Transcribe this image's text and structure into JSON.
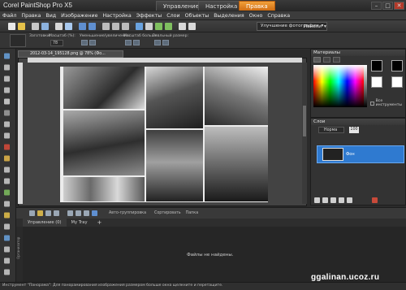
{
  "app": {
    "title": "Corel PaintShop Pro X5"
  },
  "workspace_tabs": [
    {
      "label": "Управление"
    },
    {
      "label": "Настройка"
    },
    {
      "label": "Правка"
    }
  ],
  "window_controls": {
    "minimize": "–",
    "maximize": "□",
    "close": "✕"
  },
  "menu": [
    "Файл",
    "Правка",
    "Вид",
    "Изображение",
    "Настройка",
    "Эффекты",
    "Слои",
    "Объекты",
    "Выделения",
    "Окно",
    "Справка"
  ],
  "toolbar": {
    "enhance_label": "Улучшение фотографии",
    "enhance_arrow": "▾",
    "panels_label": "Панели",
    "panels_arrow": "▾"
  },
  "options": {
    "label1": "Заготовки:",
    "label2": "Масштаб (%):",
    "value2": "78",
    "label3": "Уменьшение/увеличение:",
    "label4": "Масштаб больше:",
    "label5": "Реальный размер:"
  },
  "document": {
    "tab_label": "2012-03-14_195128.png @ 78% (Фо..."
  },
  "materials": {
    "title": "Материалы",
    "all_tools": "Все инструменты",
    "colors": {
      "fg": "#000000",
      "bg": "#000000"
    }
  },
  "layers": {
    "title": "Слои",
    "mode": "Норма",
    "opacity": "100",
    "layer_name": "Фон"
  },
  "organizer": {
    "auto_group": "Авто-группировка",
    "sort": "Сортировать",
    "sort_value": "Папка",
    "tabs": [
      "Управление (0)",
      "My Tray"
    ],
    "add_tab": "+",
    "empty_message": "Файлы не найдены.",
    "side_label": "Организатор"
  },
  "status": {
    "text": "Инструмент \"Панорама\": Для панорамирования изображения размером больше окна щелкните и перетащите."
  },
  "watermark": "ggalinan.ucoz.ru",
  "accent_colors": {
    "active_tab": "#e8891f",
    "layer_selected": "#2f7ad0"
  },
  "tool_icons": [
    "pan-icon",
    "pick-icon",
    "selection-icon",
    "freehand-selection-icon",
    "dropper-icon",
    "crop-icon",
    "straighten-icon",
    "perspective-icon",
    "red-eye-icon",
    "makeover-icon",
    "clone-icon",
    "scratch-remover-icon",
    "paint-brush-icon",
    "eraser-icon",
    "fill-icon",
    "text-icon",
    "preset-shape-icon",
    "pen-icon",
    "warp-brush-icon",
    "lighten-darken-icon"
  ]
}
